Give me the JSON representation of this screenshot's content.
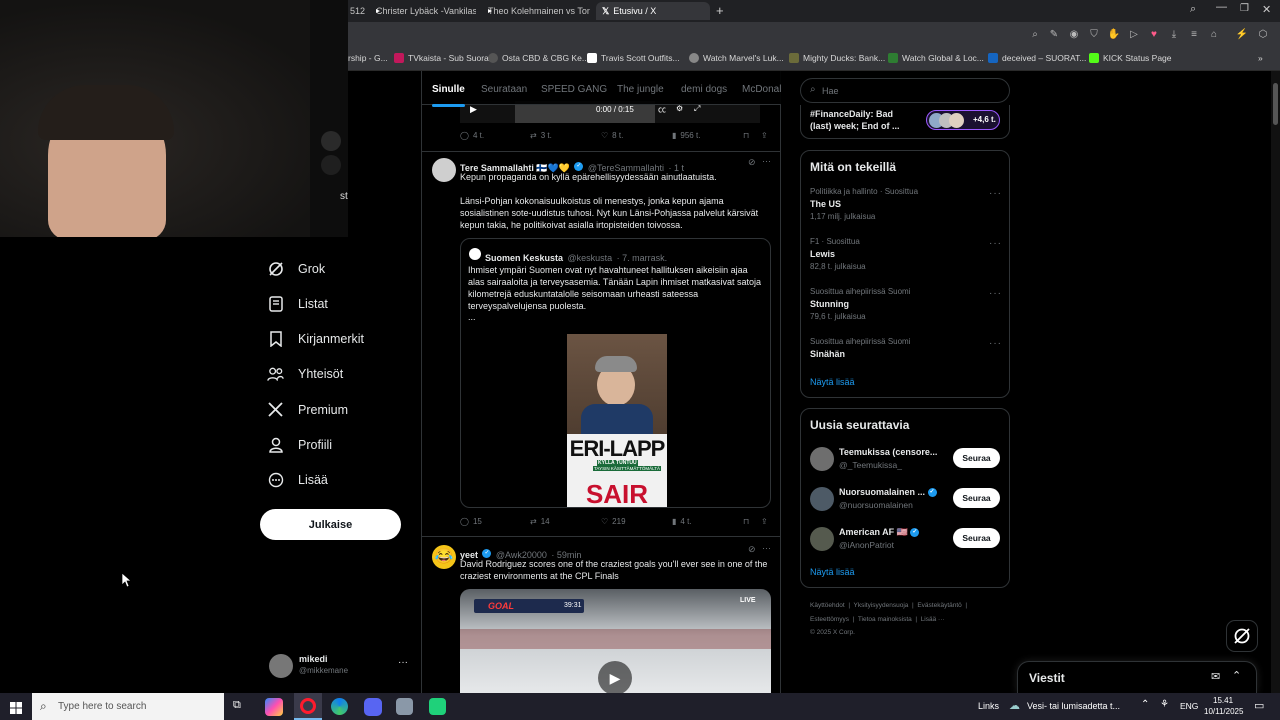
{
  "browser": {
    "tabs": [
      {
        "label": "512"
      },
      {
        "label": "Christer Lybäck -Vankilast"
      },
      {
        "label": "Theo Kolehmainen vs Ton"
      },
      {
        "label": "Etusivu / X"
      }
    ],
    "new_tab": "+",
    "bookmarks": [
      {
        "label": "rship - G..."
      },
      {
        "label": "TVkaista - Sub Suora"
      },
      {
        "label": "Osta CBD & CBG Ke..."
      },
      {
        "label": "Travis Scott Outfits..."
      },
      {
        "label": "Watch Marvel's Luk..."
      },
      {
        "label": "Mighty Ducks: Bank..."
      },
      {
        "label": "Watch Global & Loc..."
      },
      {
        "label": "deceived – SUORAT..."
      },
      {
        "label": "KICK Status Page"
      }
    ]
  },
  "webcam": {
    "overlay_text": "st"
  },
  "sidebar": {
    "items": [
      {
        "label": "Grok",
        "icon": "grok-icon"
      },
      {
        "label": "Listat",
        "icon": "list-icon"
      },
      {
        "label": "Kirjanmerkit",
        "icon": "bookmark-icon"
      },
      {
        "label": "Yhteisöt",
        "icon": "communities-icon"
      },
      {
        "label": "Premium",
        "icon": "x-logo-icon"
      },
      {
        "label": "Profiili",
        "icon": "profile-icon"
      },
      {
        "label": "Lisää",
        "icon": "more-circle-icon"
      }
    ],
    "post_button": "Julkaise",
    "account": {
      "name": "mikedi",
      "handle": "@mikkemane",
      "menu": "···"
    }
  },
  "feed": {
    "tabs": [
      "Sinulle",
      "Seurataan",
      "SPEED GANG",
      "The jungle",
      "demi dogs",
      "McDonal"
    ],
    "top_video": {
      "time": "0:00 / 0:15"
    },
    "top_actions": {
      "replies": "4 t.",
      "reposts": "3 t.",
      "likes": "8 t.",
      "views": "956 t."
    },
    "tweet1": {
      "name": "Tere Sammallahti 🇫🇮💙💛",
      "handle": "@TereSammallahti",
      "time": "· 1 t",
      "text1": "Kepun propaganda on kyllä epärehellisyydessään ainutlaatuista.",
      "text2a": "Länsi-Pohjan kokonaisuulkoistus oli menestys, jonka kepun ajama",
      "text2b": "sosialistinen sote-uudistus tuhosi. Nyt kun Länsi-Pohjassa palvelut kärsivät",
      "text2c": "kepun takia, he politikoivat asialla irtopisteiden toivossa.",
      "quote": {
        "name": "Suomen Keskusta",
        "handle": "@keskusta",
        "time": "· 7. marrask.",
        "line1": "Ihmiset ympäri Suomen ovat nyt havahtuneet hallituksen aikeisiin ajaa",
        "line2": "alas sairaaloita ja terveysasemia. Tänään Lapin ihmiset matkasivat satoja",
        "line3": "kilometrejä eduskuntatalolle seisomaan urheasti sateessa",
        "line4": "terveyspalvelujensa puolesta.",
        "ellipsis": "...",
        "sign_top": "ERI-LAPP",
        "sign_mid": "KYLLÄ TUNTUU",
        "sign_small": "TAYSIN KÄSITTÄMÄTTÖMÄLTÄ",
        "sign_bottom": "SAIR"
      },
      "actions": {
        "replies": "15",
        "reposts": "14",
        "likes": "219",
        "views": "4 t."
      }
    },
    "tweet2": {
      "name": "yeet",
      "handle": "@Awk20000",
      "time": "· 59min",
      "text1": "David Rodriguez scores one of the craziest goals you'll ever see in one of the",
      "text2": "craziest environments at the CPL Finals",
      "video_live": "LIVE",
      "video_goal": "GOAL",
      "video_clock": "39:31"
    }
  },
  "right": {
    "search_placeholder": "Hae",
    "top_trend": {
      "line1": "#FinanceDaily: Bad",
      "line2": "(last) week; End of ...",
      "count": "+4,6 t."
    },
    "trends_title": "Mitä on tekeillä",
    "trends": [
      {
        "category": "Politiikka ja hallinto · Suosittua",
        "name": "The US",
        "posts": "1,17 milj. julkaisua"
      },
      {
        "category": "F1 · Suosittua",
        "name": "Lewis",
        "posts": "82,8 t. julkaisua"
      },
      {
        "category": "Suosittua aihepiirissä Suomi",
        "name": "Stunning",
        "posts": "79,6 t. julkaisua"
      },
      {
        "category": "Suosittua aihepiirissä Suomi",
        "name": "Sinähän",
        "posts": ""
      }
    ],
    "show_more": "Näytä lisää",
    "who_title": "Uusia seurattavia",
    "suggestions": [
      {
        "name": "Teemukissa (censore...",
        "handle": "@_Teemukissa_",
        "button": "Seuraa"
      },
      {
        "name": "Nuorsuomalainen ...",
        "handle": "@nuorsuomalainen",
        "button": "Seuraa"
      },
      {
        "name": "American AF 🇺🇸",
        "handle": "@iAnonPatriot",
        "button": "Seuraa"
      }
    ],
    "show_more2": "Näytä lisää",
    "footer": {
      "l1a": "Käyttöehdot",
      "l1b": "Yksityisyydensuoja",
      "l1c": "Evästekäytäntö",
      "l2a": "Esteettömyys",
      "l2b": "Tietoa mainoksista",
      "l2c": "Lisää ···",
      "l3": "© 2025 X Corp."
    },
    "messages": "Viestit"
  },
  "taskbar": {
    "search_placeholder": "Type here to search",
    "links": "Links",
    "weather": "Vesi- tai lumisadetta t...",
    "lang": "ENG",
    "time": "15.41",
    "date": "10/11/2025"
  }
}
